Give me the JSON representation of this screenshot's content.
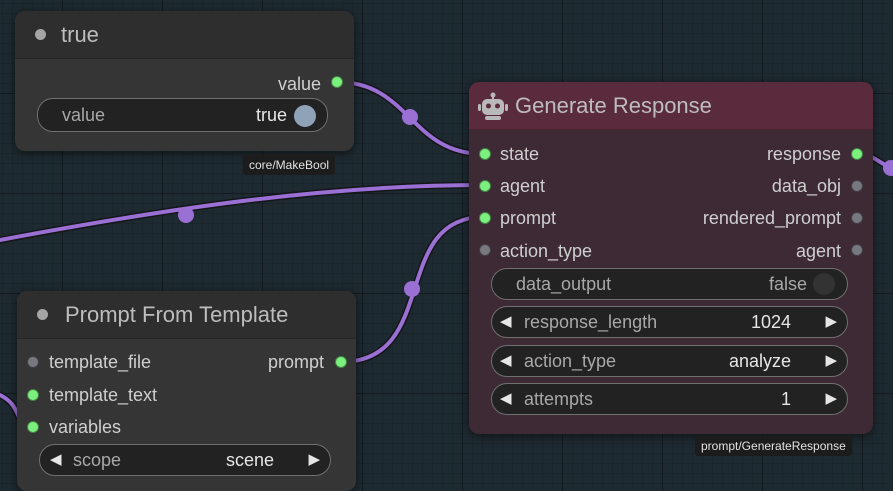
{
  "colors": {
    "wire": "#9a70d4",
    "slot_connected": "#7bf07f",
    "slot_unconnected": "#787881",
    "generate_node_body": "#3d2a35",
    "generate_node_title": "#5a2b3c"
  },
  "make_bool": {
    "title": "true",
    "output_label": "value",
    "widget": {
      "label": "value",
      "value": "true"
    },
    "tag": "core/MakeBool"
  },
  "generate_response": {
    "title": "Generate Response",
    "icon": "robot-icon",
    "inputs": [
      "state",
      "agent",
      "prompt",
      "action_type"
    ],
    "outputs": [
      "response",
      "data_obj",
      "rendered_prompt",
      "agent"
    ],
    "widgets": {
      "data_output": {
        "label": "data_output",
        "value": "false"
      },
      "response_length": {
        "label": "response_length",
        "value": "1024"
      },
      "action_type": {
        "label": "action_type",
        "value": "analyze"
      },
      "attempts": {
        "label": "attempts",
        "value": "1"
      }
    },
    "tag": "prompt/GenerateResponse"
  },
  "prompt_from_template": {
    "title": "Prompt From Template",
    "inputs": [
      "template_file",
      "template_text",
      "variables"
    ],
    "output_label": "prompt",
    "widget": {
      "label": "scope",
      "value": "scene"
    }
  }
}
